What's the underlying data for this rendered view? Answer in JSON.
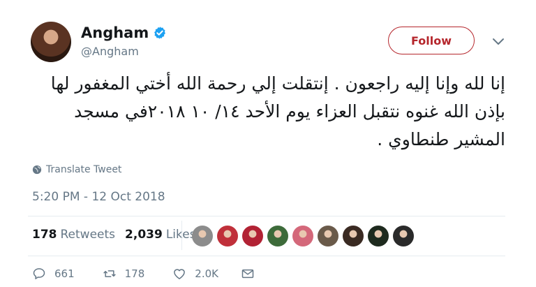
{
  "user": {
    "name": "Angham",
    "handle": "@Angham"
  },
  "follow_label": "Follow",
  "tweet": {
    "text": "إنا لله وإنا إليه راجعون . إنتقلت إلي رحمة الله أختي المغفور لها بإذن الله غنوه  نتقبل العزاء يوم الأحد  ١٤/ ١٠  ٢٠١٨في مسجد المشير طنطاوي .",
    "translate_label": "Translate Tweet",
    "timestamp": "5:20 PM - 12 Oct 2018"
  },
  "stats": {
    "retweets_count": "178",
    "retweets_label": "Retweets",
    "likes_count": "2,039",
    "likes_label": "Likes"
  },
  "likers": [
    "#8c8c8c",
    "#c0303a",
    "#b22234",
    "#3d6b3a",
    "#d4687a",
    "#6a5a4a",
    "#3a2a22",
    "#1e2a1e",
    "#2a2a2a"
  ],
  "actions": {
    "replies": "661",
    "retweets": "178",
    "likes": "2.0K"
  },
  "colors": {
    "accent": "#b5262c",
    "verified": "#1da1f2",
    "muted": "#657786"
  },
  "icons": [
    "verified-icon",
    "chevron-down-icon",
    "globe-icon",
    "reply-icon",
    "retweet-icon",
    "heart-icon",
    "mail-icon"
  ]
}
